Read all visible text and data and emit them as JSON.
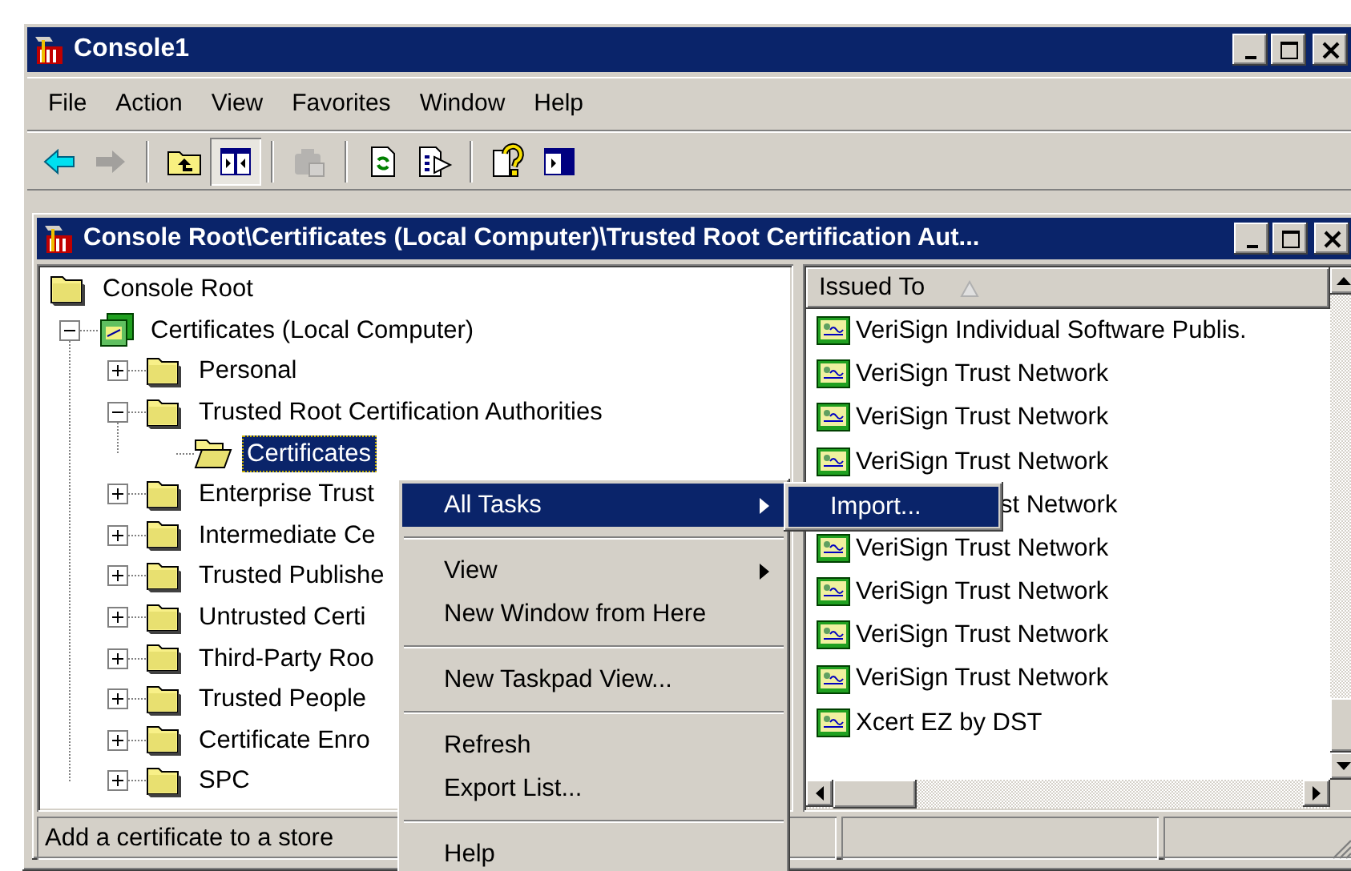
{
  "window": {
    "title": "Console1",
    "controls": [
      {
        "kind": "minimize"
      },
      {
        "kind": "maximize"
      },
      {
        "kind": "close"
      }
    ]
  },
  "menu_bar": [
    {
      "label": "File"
    },
    {
      "label": "Action"
    },
    {
      "label": "View"
    },
    {
      "label": "Favorites"
    },
    {
      "label": "Window"
    },
    {
      "label": "Help"
    }
  ],
  "toolbar_groups": [
    [
      {
        "kind": "back",
        "disabled": false,
        "pressed": false
      },
      {
        "kind": "forward",
        "disabled": true,
        "pressed": false
      }
    ],
    [
      {
        "kind": "up",
        "disabled": false,
        "pressed": false
      },
      {
        "kind": "tree-toggle",
        "disabled": false,
        "pressed": true
      }
    ],
    [
      {
        "kind": "properties",
        "disabled": true,
        "pressed": false
      }
    ],
    [
      {
        "kind": "refresh",
        "disabled": false,
        "pressed": false
      },
      {
        "kind": "export",
        "disabled": false,
        "pressed": false
      }
    ],
    [
      {
        "kind": "help",
        "disabled": false,
        "pressed": false
      },
      {
        "kind": "pane-toggle",
        "disabled": false,
        "pressed": false
      }
    ]
  ],
  "child_window": {
    "title": "Console Root\\Certificates (Local Computer)\\Trusted Root Certification Aut...",
    "controls": [
      {
        "kind": "minimize"
      },
      {
        "kind": "maximize"
      },
      {
        "kind": "close"
      }
    ]
  },
  "tree": [
    {
      "label": "Console Root",
      "kind": "root",
      "selected": false,
      "children": [
        {
          "label": "Certificates (Local Computer)",
          "kind": "store",
          "expanded": true,
          "selected": false,
          "children": [
            {
              "label": "Personal",
              "kind": "folder",
              "expanded": false,
              "selected": false
            },
            {
              "label": "Trusted Root Certification Authorities",
              "kind": "folder",
              "expanded": true,
              "selected": false,
              "children": [
                {
                  "label": "Certificates",
                  "kind": "leaf",
                  "selected": true
                }
              ]
            },
            {
              "label": "Enterprise Trust",
              "kind": "folder",
              "expanded": false,
              "selected": false
            },
            {
              "label": "Intermediate Ce",
              "kind": "folder",
              "expanded": false,
              "selected": false
            },
            {
              "label": "Trusted Publishe",
              "kind": "folder",
              "expanded": false,
              "selected": false
            },
            {
              "label": "Untrusted Certi",
              "kind": "folder",
              "expanded": false,
              "selected": false
            },
            {
              "label": "Third-Party Roo",
              "kind": "folder",
              "expanded": false,
              "selected": false
            },
            {
              "label": "Trusted People",
              "kind": "folder",
              "expanded": false,
              "selected": false
            },
            {
              "label": "Certificate Enro",
              "kind": "folder",
              "expanded": false,
              "selected": false
            },
            {
              "label": "SPC",
              "kind": "folder",
              "expanded": false,
              "selected": false
            }
          ]
        }
      ]
    }
  ],
  "list": {
    "columns": [
      {
        "label": "Issued To",
        "sorted": true
      }
    ],
    "rows": [
      {
        "text": "VeriSign Individual Software Publis.",
        "kind": "cert"
      },
      {
        "text": "VeriSign Trust Network",
        "kind": "cert"
      },
      {
        "text": "VeriSign Trust Network",
        "kind": "cert"
      },
      {
        "text": "VeriSign Trust Network",
        "kind": "cert"
      },
      {
        "text": "st Network",
        "kind": "covered"
      },
      {
        "text": "VeriSign Trust Network",
        "kind": "cert"
      },
      {
        "text": "VeriSign Trust Network",
        "kind": "cert"
      },
      {
        "text": "VeriSign Trust Network",
        "kind": "cert"
      },
      {
        "text": "VeriSign Trust Network",
        "kind": "cert"
      },
      {
        "text": "Xcert EZ by DST",
        "kind": "cert"
      }
    ]
  },
  "status_bar": {
    "text": "Add a certificate to a store"
  },
  "context_menu": [
    {
      "kind": "item",
      "label": "All Tasks",
      "submenu": true,
      "selected": true
    },
    {
      "kind": "separator"
    },
    {
      "kind": "item",
      "label": "View",
      "submenu": true,
      "selected": false
    },
    {
      "kind": "item",
      "label": "New Window from Here",
      "submenu": false,
      "selected": false
    },
    {
      "kind": "separator"
    },
    {
      "kind": "item",
      "label": "New Taskpad View...",
      "submenu": false,
      "selected": false
    },
    {
      "kind": "separator"
    },
    {
      "kind": "item",
      "label": "Refresh",
      "submenu": false,
      "selected": false
    },
    {
      "kind": "item",
      "label": "Export List...",
      "submenu": false,
      "selected": false
    },
    {
      "kind": "separator"
    },
    {
      "kind": "item",
      "label": "Help",
      "submenu": false,
      "selected": false
    }
  ],
  "submenu": [
    {
      "label": "Import...",
      "selected": true
    }
  ]
}
